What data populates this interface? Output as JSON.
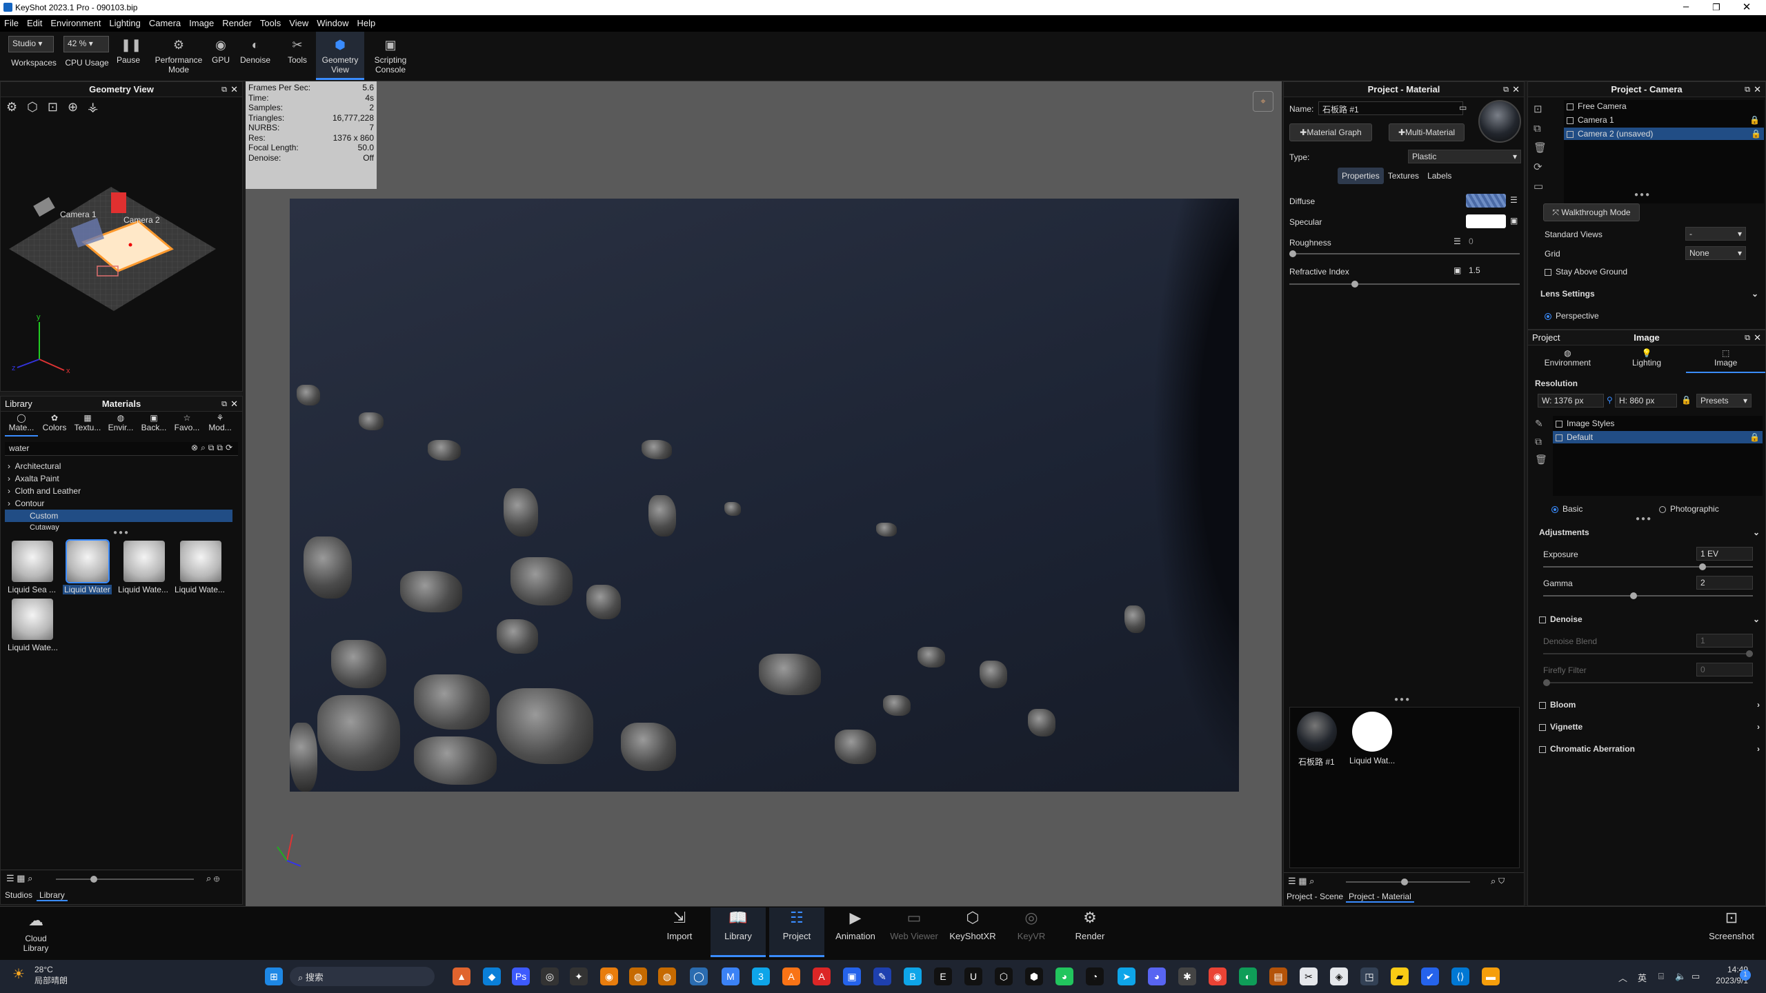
{
  "window": {
    "title": "KeyShot 2023.1 Pro  - 090103.bip"
  },
  "menu": [
    "File",
    "Edit",
    "Environment",
    "Lighting",
    "Camera",
    "Image",
    "Render",
    "Tools",
    "View",
    "Window",
    "Help"
  ],
  "toolbar": {
    "workspace_value": "Studio",
    "cpu_value": "42 %",
    "items": [
      {
        "label": "Workspaces"
      },
      {
        "label": "CPU Usage"
      },
      {
        "label": "Pause"
      },
      {
        "label": "Performance\nMode"
      },
      {
        "label": "GPU"
      },
      {
        "label": "Denoise"
      },
      {
        "label": "Tools"
      },
      {
        "label": "Geometry\nView"
      },
      {
        "label": "Scripting\nConsole"
      }
    ]
  },
  "geometry_view": {
    "title": "Geometry View",
    "camera1": "Camera 1",
    "camera2": "Camera 2",
    "axis_x": "x",
    "axis_y": "y",
    "axis_z": "z"
  },
  "stats": [
    {
      "k": "Frames Per Sec:",
      "v": "5.6"
    },
    {
      "k": "Time:",
      "v": "4s"
    },
    {
      "k": "Samples:",
      "v": "2"
    },
    {
      "k": "Triangles:",
      "v": "16,777,228"
    },
    {
      "k": "NURBS:",
      "v": "7"
    },
    {
      "k": "Res:",
      "v": "1376 x 860"
    },
    {
      "k": "Focal Length:",
      "v": "50.0"
    },
    {
      "k": "Denoise:",
      "v": "Off"
    }
  ],
  "library": {
    "left_label": "Library",
    "title": "Materials",
    "tabs": [
      "Mate...",
      "Colors",
      "Textu...",
      "Envir...",
      "Back...",
      "Favo...",
      "Mod..."
    ],
    "search_value": "water",
    "tree": [
      "Architectural",
      "Axalta Paint",
      "Cloth and Leather",
      "Contour",
      "Custom",
      "Cutaway"
    ],
    "thumbs": [
      "Liquid Sea ...",
      "Liquid Water",
      "Liquid Wate...",
      "Liquid Wate...",
      "Liquid Wate..."
    ],
    "bottom_tabs": [
      "Studios",
      "Library"
    ]
  },
  "material": {
    "title": "Project - Material",
    "name_label": "Name:",
    "name_value": "石板路 #1",
    "material_graph": "Material Graph",
    "multi_material": "Multi-Material",
    "type_label": "Type:",
    "type_value": "Plastic",
    "tabs": [
      "Properties",
      "Textures",
      "Labels"
    ],
    "diffuse": "Diffuse",
    "diffuse_color": "#5a7ab6",
    "specular": "Specular",
    "roughness": "Roughness",
    "roughness_value": "0",
    "refractive": "Refractive Index",
    "refractive_value": "1.5",
    "thumbs": [
      "石板路 #1",
      "Liquid Wat..."
    ],
    "bottom_tabs": [
      "Project - Scene",
      "Project - Material"
    ]
  },
  "camera": {
    "title": "Project - Camera",
    "list": [
      "Free Camera",
      "Camera 1",
      "Camera 2 (unsaved)"
    ],
    "walkthrough": "Walkthrough Mode",
    "standard_views": "Standard Views",
    "standard_value": "-",
    "grid": "Grid",
    "grid_value": "None",
    "stay_above": "Stay Above Ground",
    "lens_settings": "Lens Settings",
    "perspective": "Perspective"
  },
  "image": {
    "project_label": "Project",
    "title": "Image",
    "tabs": [
      "Environment",
      "Lighting",
      "Image"
    ],
    "resolution": "Resolution",
    "w": "W: 1376 px",
    "h": "H: 860 px",
    "presets": "Presets",
    "styles_header": "Image Styles",
    "style_default": "Default",
    "basic": "Basic",
    "photographic": "Photographic",
    "adjustments": "Adjustments",
    "exposure": "Exposure",
    "exposure_value": "1 EV",
    "gamma": "Gamma",
    "gamma_value": "2",
    "denoise": "Denoise",
    "denoise_blend": "Denoise Blend",
    "denoise_blend_value": "1",
    "firefly": "Firefly Filter",
    "firefly_value": "0",
    "bloom": "Bloom",
    "vignette": "Vignette",
    "chromatic": "Chromatic Aberration"
  },
  "bottom": {
    "cloud": "Cloud\nLibrary",
    "items": [
      "Import",
      "Library",
      "Project",
      "Animation",
      "Web Viewer",
      "KeyShotXR",
      "KeyVR",
      "Render"
    ],
    "screenshot": "Screenshot"
  },
  "taskbar": {
    "weather_temp": "28°C",
    "weather_desc": "局部晴朗",
    "search": "搜索",
    "time": "14:49",
    "date": "2023/9/1",
    "lang": "英",
    "notif": "1"
  }
}
